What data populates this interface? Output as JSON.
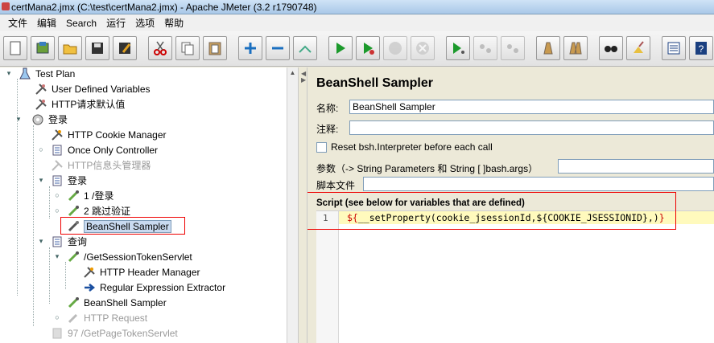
{
  "window": {
    "title": "certMana2.jmx (C:\\test\\certMana2.jmx) - Apache JMeter (3.2 r1790748)"
  },
  "menu": [
    "文件",
    "编辑",
    "Search",
    "运行",
    "选项",
    "帮助"
  ],
  "toolbar": {
    "buttons": [
      {
        "name": "new-icon"
      },
      {
        "name": "templates-icon"
      },
      {
        "name": "open-icon"
      },
      {
        "name": "save-icon"
      },
      {
        "name": "save-as-icon"
      },
      {
        "name": "cut-icon"
      },
      {
        "name": "copy-icon"
      },
      {
        "name": "paste-icon"
      },
      {
        "name": "expand-icon"
      },
      {
        "name": "collapse-icon"
      },
      {
        "name": "toggle-icon"
      },
      {
        "name": "start-icon"
      },
      {
        "name": "start-no-pause-icon"
      },
      {
        "name": "stop-icon"
      },
      {
        "name": "shutdown-icon"
      },
      {
        "name": "remote-start-icon"
      },
      {
        "name": "remote-stop-icon"
      },
      {
        "name": "remote-shutdown-icon"
      },
      {
        "name": "clear-icon"
      },
      {
        "name": "clear-all-icon"
      },
      {
        "name": "search-icon"
      },
      {
        "name": "reset-search-icon"
      },
      {
        "name": "function-helper-icon"
      },
      {
        "name": "help-icon"
      }
    ]
  },
  "tree": {
    "nodes": [
      {
        "label": "Test Plan"
      },
      {
        "label": "User Defined Variables"
      },
      {
        "label": "HTTP请求默认值"
      },
      {
        "label": "登录"
      },
      {
        "label": "HTTP Cookie Manager"
      },
      {
        "label": "Once Only Controller"
      },
      {
        "label": "HTTP信息头管理器"
      },
      {
        "label": "登录"
      },
      {
        "label": "1 /登录"
      },
      {
        "label": "2 跳过验证"
      },
      {
        "label": "BeanShell Sampler"
      },
      {
        "label": "查询"
      },
      {
        "label": "/GetSessionTokenServlet"
      },
      {
        "label": "HTTP Header Manager"
      },
      {
        "label": "Regular Expression Extractor"
      },
      {
        "label": "BeanShell Sampler"
      },
      {
        "label": "HTTP Request"
      },
      {
        "label": "97 /GetPageTokenServlet"
      }
    ]
  },
  "panel": {
    "title": "BeanShell Sampler",
    "name_label": "名称:",
    "name_value": "BeanShell Sampler",
    "comment_label": "注释:",
    "comment_value": "",
    "reset_label": "Reset bsh.Interpreter before each call",
    "params_label": "参数（-> String Parameters 和 String [ ]bash.args）",
    "params_value": "",
    "script_file_label": "脚本文件",
    "script_file_value": "",
    "script_label": "Script (see below for variables that are defined)",
    "script_line_number": "1",
    "script_open": "${",
    "script_body": "__setProperty(cookie_jsessionId,${COOKIE_JSESSIONID},)",
    "script_close": "}"
  }
}
